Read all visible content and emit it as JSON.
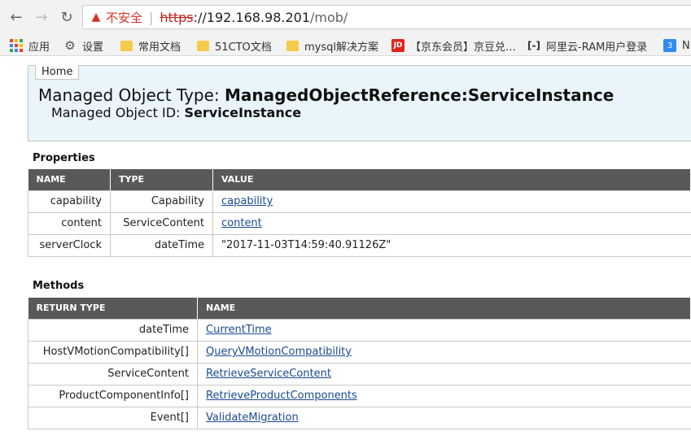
{
  "browser": {
    "back_icon": "arrow-left-icon",
    "forward_icon": "arrow-right-icon",
    "reload_icon": "reload-icon",
    "security_label": "不安全",
    "url_scheme": "https",
    "url_scheme_sep": "://",
    "url_host": "192.168.98.201",
    "url_path": "/mob/"
  },
  "bookmarks": [
    {
      "label": "应用",
      "icon": "apps-grid-icon"
    },
    {
      "label": "设置",
      "icon": "gear-icon"
    },
    {
      "label": "常用文档",
      "icon": "folder-icon"
    },
    {
      "label": "51CTO文档",
      "icon": "folder-icon"
    },
    {
      "label": "mysql解决方案",
      "icon": "folder-icon"
    },
    {
      "label": "【京东会员】京豆兑…",
      "icon": "jd-icon",
      "icon_text": "JD"
    },
    {
      "label": "阿里云-RAM用户登录",
      "icon": "aliyun-icon",
      "icon_text": "[-]"
    },
    {
      "label": "N",
      "icon": "n-icon",
      "icon_text": "3"
    }
  ],
  "page": {
    "home_label": "Home",
    "mo_type_prefix": "Managed Object Type: ",
    "mo_type_value": "ManagedObjectReference:ServiceInstance",
    "mo_id_prefix": "Managed Object ID: ",
    "mo_id_value": "ServiceInstance"
  },
  "properties": {
    "title": "Properties",
    "headers": [
      "NAME",
      "TYPE",
      "VALUE"
    ],
    "rows": [
      {
        "name": "capability",
        "type": "Capability",
        "value": "capability",
        "link": true
      },
      {
        "name": "content",
        "type": "ServiceContent",
        "value": "content",
        "link": true
      },
      {
        "name": "serverClock",
        "type": "dateTime",
        "value": "\"2017-11-03T14:59:40.91126Z\"",
        "link": false
      }
    ]
  },
  "methods": {
    "title": "Methods",
    "headers": [
      "RETURN TYPE",
      "NAME"
    ],
    "rows": [
      {
        "return_type": "dateTime",
        "name": "CurrentTime"
      },
      {
        "return_type": "HostVMotionCompatibility[]",
        "name": "QueryVMotionCompatibility"
      },
      {
        "return_type": "ServiceContent",
        "name": "RetrieveServiceContent"
      },
      {
        "return_type": "ProductComponentInfo[]",
        "name": "RetrieveProductComponents"
      },
      {
        "return_type": "Event[]",
        "name": "ValidateMigration"
      }
    ]
  },
  "colors": {
    "header_bg": "#eaf4fb",
    "table_header_bg": "#595959",
    "link": "#1a4a8f",
    "insecure_red": "#d93025"
  }
}
